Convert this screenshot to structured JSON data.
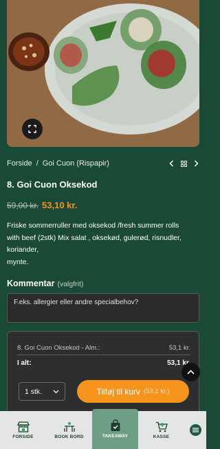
{
  "breadcrumb": {
    "home": "Forside",
    "separator": "/",
    "category": "Goi Cuon (Rispapir)"
  },
  "product": {
    "title": "8. Goi Cuon Oksekod",
    "old_price": "59,00 kr.",
    "new_price": "53,10 kr.",
    "description_lines": [
      "Friske sommerruller med oksekod /fresh summer rolls",
      "with beef (2stk) Mix salat , oksekød, gulerød, risnudler,",
      "koriander,",
      "mynte."
    ],
    "image_icon": "expand-icon"
  },
  "comment": {
    "label": "Kommentar",
    "optional": "(valgfrit)",
    "placeholder": "F.eks. allergier eller andre specialbehov?"
  },
  "order_summary": {
    "line_item": "8. Goi Cuon Oksekod - Alm.:",
    "line_price": "53,1 kr.",
    "total_label": "I alt:",
    "total_price": "53,1 kr."
  },
  "cart": {
    "quantity": "1 stk.",
    "add_label": "Tilføj til kurv",
    "add_price": "(53,1 kr.)"
  },
  "bottom_nav": {
    "items": [
      {
        "label": "FORSIDE",
        "icon": "store-icon"
      },
      {
        "label": "BOOK BORD",
        "icon": "table-icon"
      },
      {
        "label": "TAKEAWAY",
        "icon": "bag-icon"
      },
      {
        "label": "KASSE",
        "icon": "cart-icon"
      }
    ],
    "menu_icon": "menu-icon"
  },
  "colors": {
    "background": "#1a4a35",
    "accent": "#f7941d",
    "nav_active": "#6f9e87"
  }
}
